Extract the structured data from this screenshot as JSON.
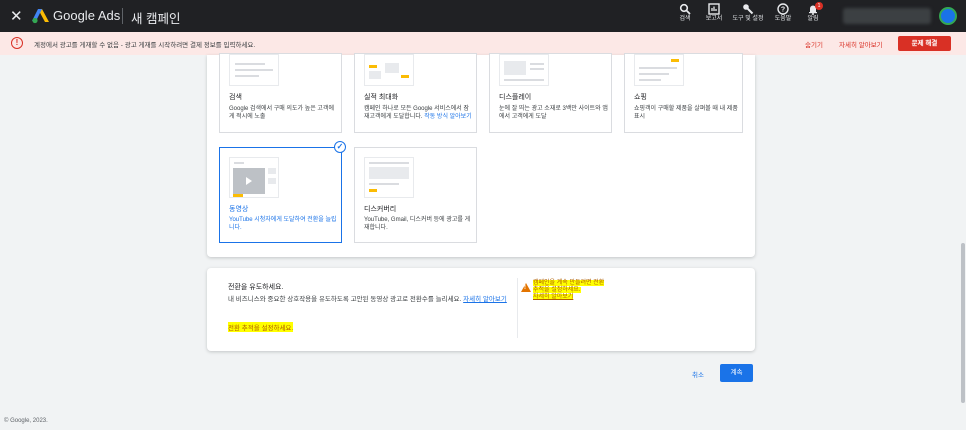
{
  "header": {
    "close_icon": "close-icon",
    "brand": "Google Ads",
    "title": "새 캠페인",
    "tools": [
      {
        "icon": "search-icon",
        "label": "검색"
      },
      {
        "icon": "report-icon",
        "label": "보고서"
      },
      {
        "icon": "wrench-icon",
        "label": "도구 및 설정"
      },
      {
        "icon": "help-icon",
        "label": "도움말"
      },
      {
        "icon": "bell-icon",
        "label": "알림",
        "badge": "1"
      }
    ]
  },
  "alert": {
    "message": "계정에서 광고를 게재할 수 없음 - 광고 게재를 시작하려면 결제 정보를 입력하세요.",
    "hide": "숨기기",
    "learn_more": "자세히 알아보기",
    "fix_button": "문제 해결"
  },
  "goals": [
    {
      "title": "검색",
      "desc": "Google 검색에서 구매 의도가 높은 고객에게 적시에 노출",
      "selected": false
    },
    {
      "title": "실적 최대화",
      "desc": "캠페인 하나로 모든 Google 서비스에서 잠재고객에게 도달합니다.",
      "link": "작동 방식 알아보기",
      "selected": false
    },
    {
      "title": "디스플레이",
      "desc": "눈에 잘 띄는 광고 소재로 3백만 사이트와 앱에서 고객에게 도달",
      "selected": false
    },
    {
      "title": "쇼핑",
      "desc": "쇼핑객이 구매할 제품을 살펴볼 때 내 제품 표시",
      "selected": false
    },
    {
      "title": "동영상",
      "desc": "YouTube 시청자에게 도달하여 전환을 늘립니다.",
      "selected": true
    },
    {
      "title": "디스커버리",
      "desc": "YouTube, Gmail, 디스커버 등에 광고를 게재합니다.",
      "selected": false
    }
  ],
  "conversion": {
    "title": "전환을 유도하세요.",
    "desc": "내 비즈니스와 중요한 상호작용을 유도하도록 고안된 동영상 광고로 전환수를 늘리세요.",
    "desc_link": "자세히 알아보기",
    "setup_link": "전환 추적을 설정하세요.",
    "warning_line1": "캠페인을 계속 만들려면 전환",
    "warning_line2": "추적을 설정하세요.",
    "warning_link": "자세히 알아보기"
  },
  "actions": {
    "cancel": "취소",
    "continue": "계속"
  },
  "footer": {
    "copyright": "© Google, 2023."
  },
  "colors": {
    "header_bg": "#202124",
    "alert_bg": "#fce8e6",
    "alert_accent": "#d93025",
    "primary": "#1a73e8",
    "highlight": "#ffff00"
  }
}
